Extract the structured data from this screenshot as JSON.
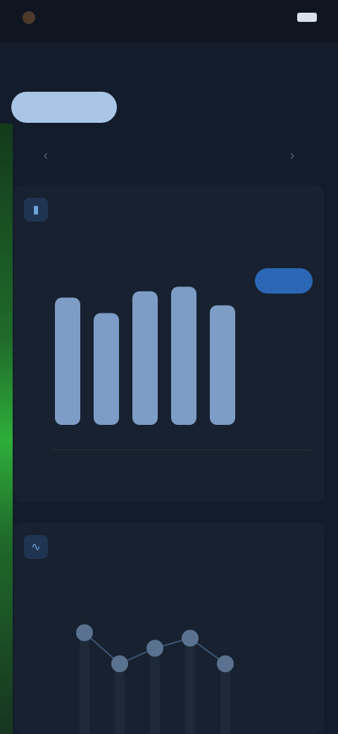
{
  "status_bar": {
    "brand": "",
    "time": "",
    "battery": ""
  },
  "header": {
    "back": "",
    "title": ""
  },
  "segment": {
    "tabs": [
      {
        "label": "",
        "active": true
      },
      {
        "label": "",
        "active": false
      },
      {
        "label": "",
        "active": false
      }
    ]
  },
  "date_nav": {
    "prev": "‹",
    "label": "",
    "next": "›"
  },
  "card1": {
    "title": "",
    "subtitle": "",
    "value": "",
    "value_sub": "",
    "pill": "",
    "icon": "bar-chart-icon"
  },
  "card2": {
    "title": "",
    "subtitle": "",
    "value": "",
    "value_sub": "",
    "icon": "line-chart-icon"
  },
  "colors": {
    "background": "#131c2a",
    "accent_green": "#2fae3a",
    "bar_blue": "#8fb3e0",
    "pill_blue": "#2b67b5"
  },
  "chart_data": [
    {
      "type": "bar",
      "categories": [
        "",
        "",
        "",
        "",
        ""
      ],
      "values": [
        0.82,
        0.72,
        0.86,
        0.89,
        0.77
      ],
      "title": "",
      "xlabel": "",
      "ylabel": "",
      "ylim": [
        0,
        1
      ]
    },
    {
      "type": "line",
      "x": [
        1,
        2,
        3,
        4,
        5
      ],
      "values": [
        0.85,
        0.45,
        0.65,
        0.78,
        0.45
      ],
      "title": "",
      "ylim": [
        0,
        1
      ]
    }
  ]
}
